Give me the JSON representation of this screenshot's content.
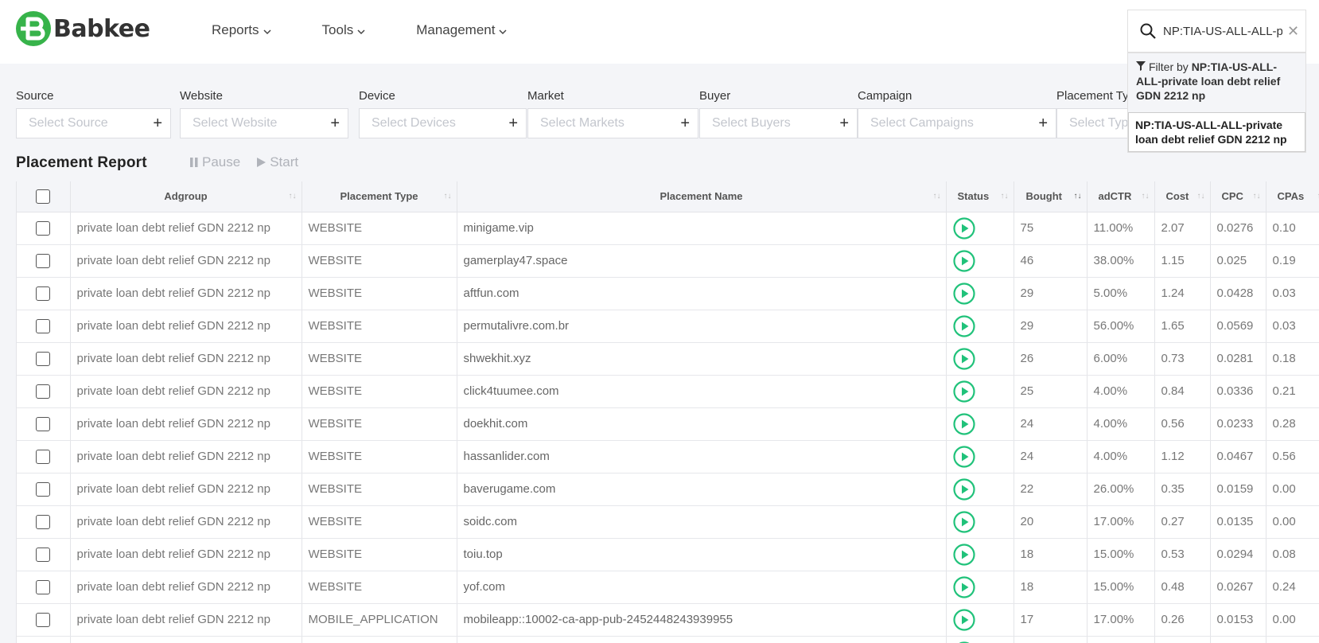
{
  "brand": {
    "name": "Babkee",
    "color": "#37b34a"
  },
  "nav": [
    {
      "label": "Reports"
    },
    {
      "label": "Tools"
    },
    {
      "label": "Management"
    }
  ],
  "search": {
    "value": "NP:TIA-US-ALL-ALL-p",
    "clear": "✕"
  },
  "dropdown": {
    "filter_prefix": "Filter by",
    "filter_value": "NP:TIA-US-ALL-ALL-private loan debt relief GDN 2212 np",
    "option": "NP:TIA-US-ALL-ALL-private loan debt relief GDN 2212 np"
  },
  "filters": [
    {
      "label": "Source",
      "placeholder": "Select Source"
    },
    {
      "label": "Website",
      "placeholder": "Select Website"
    },
    {
      "label": "Device",
      "placeholder": "Select Devices"
    },
    {
      "label": "Market",
      "placeholder": "Select Markets"
    },
    {
      "label": "Buyer",
      "placeholder": "Select Buyers"
    },
    {
      "label": "Campaign",
      "placeholder": "Select Campaigns"
    },
    {
      "label": "Placement Type",
      "placeholder": "Select Type"
    }
  ],
  "report": {
    "title": "Placement Report",
    "pause_label": "Pause",
    "start_label": "Start"
  },
  "table": {
    "columns": [
      "Adgroup",
      "Placement Type",
      "Placement Name",
      "Status",
      "Bought",
      "adCTR",
      "Cost",
      "CPC",
      "CPAs"
    ],
    "rows": [
      {
        "adgroup": "private loan debt relief GDN 2212 np",
        "type": "WEBSITE",
        "name": "minigame.vip",
        "bought": "75",
        "ctr": "11.00%",
        "cost": "2.07",
        "cpc": "0.0276",
        "cpa": "0.10"
      },
      {
        "adgroup": "private loan debt relief GDN 2212 np",
        "type": "WEBSITE",
        "name": "gamerplay47.space",
        "bought": "46",
        "ctr": "38.00%",
        "cost": "1.15",
        "cpc": "0.025",
        "cpa": "0.19"
      },
      {
        "adgroup": "private loan debt relief GDN 2212 np",
        "type": "WEBSITE",
        "name": "aftfun.com",
        "bought": "29",
        "ctr": "5.00%",
        "cost": "1.24",
        "cpc": "0.0428",
        "cpa": "0.03"
      },
      {
        "adgroup": "private loan debt relief GDN 2212 np",
        "type": "WEBSITE",
        "name": "permutalivre.com.br",
        "bought": "29",
        "ctr": "56.00%",
        "cost": "1.65",
        "cpc": "0.0569",
        "cpa": "0.03"
      },
      {
        "adgroup": "private loan debt relief GDN 2212 np",
        "type": "WEBSITE",
        "name": "shwekhit.xyz",
        "bought": "26",
        "ctr": "6.00%",
        "cost": "0.73",
        "cpc": "0.0281",
        "cpa": "0.18"
      },
      {
        "adgroup": "private loan debt relief GDN 2212 np",
        "type": "WEBSITE",
        "name": "click4tuumee.com",
        "bought": "25",
        "ctr": "4.00%",
        "cost": "0.84",
        "cpc": "0.0336",
        "cpa": "0.21"
      },
      {
        "adgroup": "private loan debt relief GDN 2212 np",
        "type": "WEBSITE",
        "name": "doekhit.com",
        "bought": "24",
        "ctr": "4.00%",
        "cost": "0.56",
        "cpc": "0.0233",
        "cpa": "0.28"
      },
      {
        "adgroup": "private loan debt relief GDN 2212 np",
        "type": "WEBSITE",
        "name": "hassanlider.com",
        "bought": "24",
        "ctr": "4.00%",
        "cost": "1.12",
        "cpc": "0.0467",
        "cpa": "0.56"
      },
      {
        "adgroup": "private loan debt relief GDN 2212 np",
        "type": "WEBSITE",
        "name": "baverugame.com",
        "bought": "22",
        "ctr": "26.00%",
        "cost": "0.35",
        "cpc": "0.0159",
        "cpa": "0.00"
      },
      {
        "adgroup": "private loan debt relief GDN 2212 np",
        "type": "WEBSITE",
        "name": "soidc.com",
        "bought": "20",
        "ctr": "17.00%",
        "cost": "0.27",
        "cpc": "0.0135",
        "cpa": "0.00"
      },
      {
        "adgroup": "private loan debt relief GDN 2212 np",
        "type": "WEBSITE",
        "name": "toiu.top",
        "bought": "18",
        "ctr": "15.00%",
        "cost": "0.53",
        "cpc": "0.0294",
        "cpa": "0.08"
      },
      {
        "adgroup": "private loan debt relief GDN 2212 np",
        "type": "WEBSITE",
        "name": "yof.com",
        "bought": "18",
        "ctr": "15.00%",
        "cost": "0.48",
        "cpc": "0.0267",
        "cpa": "0.24"
      },
      {
        "adgroup": "private loan debt relief GDN 2212 np",
        "type": "MOBILE_APPLICATION",
        "name": "mobileapp::10002-ca-app-pub-2452448243939955",
        "bought": "17",
        "ctr": "17.00%",
        "cost": "0.26",
        "cpc": "0.0153",
        "cpa": "0.00"
      },
      {
        "adgroup": "",
        "type": "",
        "name": "",
        "bought": "",
        "ctr": "",
        "cost": "",
        "cpc": "",
        "cpa": ""
      }
    ]
  },
  "colors": {
    "accent": "#37b34a",
    "play": "#20c27a",
    "bg": "#f4f5f8"
  }
}
